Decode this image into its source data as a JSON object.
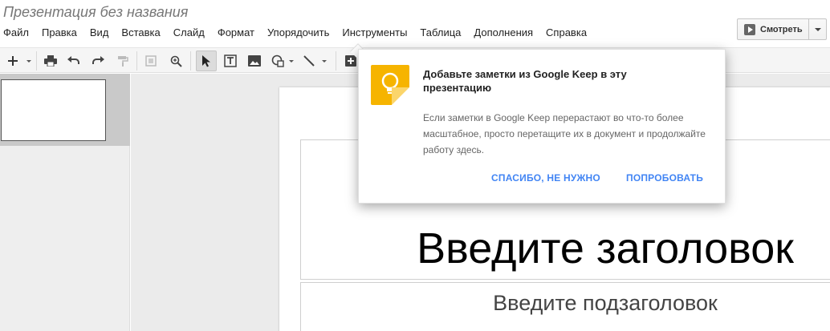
{
  "document": {
    "title": "Презентация без названия"
  },
  "menu": {
    "items": [
      "Файл",
      "Правка",
      "Вид",
      "Вставка",
      "Слайд",
      "Формат",
      "Упорядочить",
      "Инструменты",
      "Таблица",
      "Дополнения",
      "Справка"
    ]
  },
  "present": {
    "label": "Смотреть"
  },
  "toolbar": {
    "icons": [
      "new-slide-icon",
      "print-icon",
      "undo-icon",
      "redo-icon",
      "paint-format-icon",
      "zoom-fit-icon",
      "zoom-icon",
      "select-cursor-icon",
      "text-box-icon",
      "image-icon",
      "shape-icon",
      "line-icon",
      "insert-icon"
    ]
  },
  "slide": {
    "title_placeholder": "Введите заголовок",
    "subtitle_placeholder": "Введите подзаголовок"
  },
  "promo": {
    "title": "Добавьте заметки из Google Keep в эту презентацию",
    "body": "Если заметки в Google Keep перерастают во что-то более масштабное, просто перетащите их в документ и продолжайте работу здесь.",
    "dismiss_label": "СПАСИБО, НЕ НУЖНО",
    "try_label": "ПОПРОБОВАТЬ",
    "logo_icon": "google-keep-icon",
    "accent_color": "#4285f4",
    "logo_color": "#f6b400"
  }
}
